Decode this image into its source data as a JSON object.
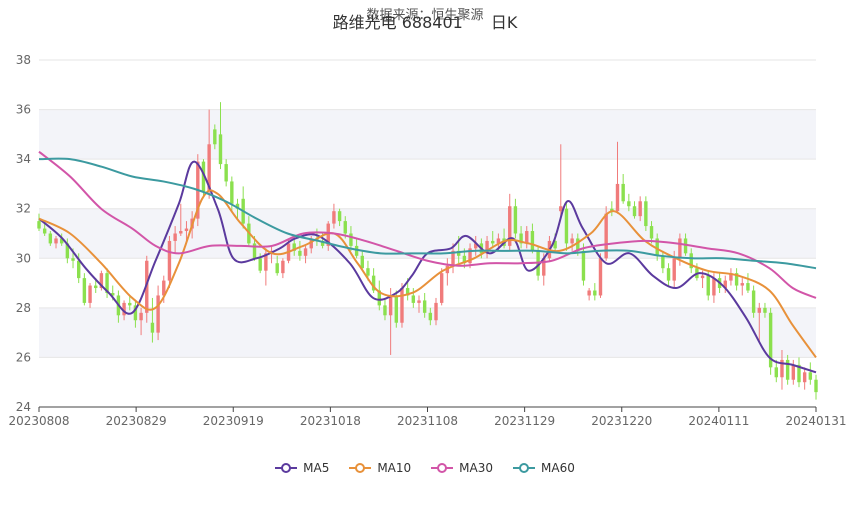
{
  "header": {
    "source": "数据来源：恒生聚源",
    "title": "路维光电 688401",
    "period": "日K"
  },
  "legend": [
    {
      "name": "MA5",
      "color": "#5b3a9e"
    },
    {
      "name": "MA10",
      "color": "#e8913a"
    },
    {
      "name": "MA30",
      "color": "#d255a8"
    },
    {
      "name": "MA60",
      "color": "#3c9aa0"
    }
  ],
  "colors": {
    "up": "#f07b7b",
    "down": "#8be04e",
    "grid": "#e6e6e6",
    "band": "#f3f4f9"
  },
  "chart_data": {
    "type": "candlestick",
    "title": "路维光电 688401 日K",
    "ylim": [
      24,
      38
    ],
    "y_ticks": [
      "24",
      "26",
      "28",
      "30",
      "32",
      "34",
      "36",
      "38"
    ],
    "x_ticks": [
      "20230808",
      "20230829",
      "20230919",
      "20231018",
      "20231108",
      "20231129",
      "20231220",
      "20240111",
      "20240131"
    ],
    "grid": true,
    "legend_position": "bottom",
    "candles": [
      {
        "o": 31.5,
        "h": 31.8,
        "l": 31.1,
        "c": 31.2
      },
      {
        "o": 31.2,
        "h": 31.4,
        "l": 30.9,
        "c": 31.0
      },
      {
        "o": 31.0,
        "h": 31.1,
        "l": 30.5,
        "c": 30.6
      },
      {
        "o": 30.6,
        "h": 30.9,
        "l": 30.4,
        "c": 30.8
      },
      {
        "o": 30.8,
        "h": 31.0,
        "l": 30.5,
        "c": 30.6
      },
      {
        "o": 30.6,
        "h": 30.8,
        "l": 29.8,
        "c": 30.0
      },
      {
        "o": 30.0,
        "h": 30.4,
        "l": 29.6,
        "c": 29.9
      },
      {
        "o": 29.9,
        "h": 30.2,
        "l": 29.0,
        "c": 29.2
      },
      {
        "o": 29.2,
        "h": 29.4,
        "l": 28.1,
        "c": 28.2
      },
      {
        "o": 28.2,
        "h": 29.0,
        "l": 28.0,
        "c": 28.9
      },
      {
        "o": 28.9,
        "h": 29.2,
        "l": 28.6,
        "c": 28.8
      },
      {
        "o": 28.8,
        "h": 29.5,
        "l": 28.7,
        "c": 29.4
      },
      {
        "o": 29.4,
        "h": 29.6,
        "l": 28.4,
        "c": 28.6
      },
      {
        "o": 28.6,
        "h": 28.9,
        "l": 28.3,
        "c": 28.5
      },
      {
        "o": 28.5,
        "h": 28.7,
        "l": 27.4,
        "c": 27.7
      },
      {
        "o": 27.7,
        "h": 28.3,
        "l": 27.5,
        "c": 28.2
      },
      {
        "o": 28.2,
        "h": 28.5,
        "l": 27.9,
        "c": 28.1
      },
      {
        "o": 28.1,
        "h": 28.3,
        "l": 27.2,
        "c": 27.5
      },
      {
        "o": 27.5,
        "h": 28.0,
        "l": 26.9,
        "c": 27.8
      },
      {
        "o": 27.8,
        "h": 30.1,
        "l": 27.4,
        "c": 29.9
      },
      {
        "o": 27.4,
        "h": 28.4,
        "l": 26.6,
        "c": 27.0
      },
      {
        "o": 27.0,
        "h": 28.9,
        "l": 26.7,
        "c": 28.5
      },
      {
        "o": 28.5,
        "h": 29.3,
        "l": 28.2,
        "c": 29.1
      },
      {
        "o": 29.1,
        "h": 30.9,
        "l": 28.8,
        "c": 30.7
      },
      {
        "o": 30.7,
        "h": 31.3,
        "l": 30.2,
        "c": 31.0
      },
      {
        "o": 31.0,
        "h": 32.2,
        "l": 30.9,
        "c": 31.1
      },
      {
        "o": 31.1,
        "h": 31.5,
        "l": 30.6,
        "c": 31.2
      },
      {
        "o": 31.2,
        "h": 31.9,
        "l": 30.8,
        "c": 31.6
      },
      {
        "o": 31.6,
        "h": 34.2,
        "l": 31.3,
        "c": 33.9
      },
      {
        "o": 33.9,
        "h": 34.0,
        "l": 32.5,
        "c": 32.7
      },
      {
        "o": 32.7,
        "h": 36.0,
        "l": 32.4,
        "c": 34.6
      },
      {
        "o": 35.2,
        "h": 35.4,
        "l": 34.4,
        "c": 34.6
      },
      {
        "o": 35.0,
        "h": 36.3,
        "l": 33.6,
        "c": 33.8
      },
      {
        "o": 33.8,
        "h": 34.0,
        "l": 32.9,
        "c": 33.1
      },
      {
        "o": 33.1,
        "h": 33.3,
        "l": 31.9,
        "c": 32.2
      },
      {
        "o": 32.2,
        "h": 32.4,
        "l": 31.6,
        "c": 32.0
      },
      {
        "o": 32.4,
        "h": 32.9,
        "l": 31.2,
        "c": 31.4
      },
      {
        "o": 31.4,
        "h": 31.7,
        "l": 30.5,
        "c": 30.6
      },
      {
        "o": 30.6,
        "h": 30.9,
        "l": 29.9,
        "c": 30.0
      },
      {
        "o": 30.0,
        "h": 30.2,
        "l": 29.4,
        "c": 29.5
      },
      {
        "o": 29.5,
        "h": 30.4,
        "l": 28.9,
        "c": 30.2
      },
      {
        "o": 30.2,
        "h": 30.5,
        "l": 29.8,
        "c": 30.3
      },
      {
        "o": 29.8,
        "h": 30.1,
        "l": 29.3,
        "c": 29.4
      },
      {
        "o": 29.4,
        "h": 30.0,
        "l": 29.2,
        "c": 29.9
      },
      {
        "o": 29.9,
        "h": 30.8,
        "l": 29.8,
        "c": 30.6
      },
      {
        "o": 30.6,
        "h": 30.9,
        "l": 30.1,
        "c": 30.3
      },
      {
        "o": 30.3,
        "h": 30.7,
        "l": 29.9,
        "c": 30.1
      },
      {
        "o": 30.1,
        "h": 30.5,
        "l": 29.8,
        "c": 30.4
      },
      {
        "o": 30.4,
        "h": 30.9,
        "l": 30.2,
        "c": 30.8
      },
      {
        "o": 30.8,
        "h": 31.2,
        "l": 30.5,
        "c": 30.7
      },
      {
        "o": 30.7,
        "h": 31.0,
        "l": 30.4,
        "c": 30.5
      },
      {
        "o": 30.5,
        "h": 31.5,
        "l": 30.3,
        "c": 31.4
      },
      {
        "o": 31.4,
        "h": 32.2,
        "l": 31.2,
        "c": 31.9
      },
      {
        "o": 31.9,
        "h": 32.0,
        "l": 31.3,
        "c": 31.5
      },
      {
        "o": 31.5,
        "h": 31.7,
        "l": 30.8,
        "c": 31.0
      },
      {
        "o": 31.0,
        "h": 31.3,
        "l": 30.3,
        "c": 30.5
      },
      {
        "o": 30.5,
        "h": 30.8,
        "l": 30.0,
        "c": 30.1
      },
      {
        "o": 30.1,
        "h": 30.3,
        "l": 29.5,
        "c": 29.6
      },
      {
        "o": 29.6,
        "h": 29.9,
        "l": 29.1,
        "c": 29.3
      },
      {
        "o": 29.3,
        "h": 29.6,
        "l": 28.6,
        "c": 28.7
      },
      {
        "o": 28.7,
        "h": 29.1,
        "l": 27.9,
        "c": 28.1
      },
      {
        "o": 28.1,
        "h": 28.4,
        "l": 27.5,
        "c": 27.7
      },
      {
        "o": 27.7,
        "h": 28.8,
        "l": 26.1,
        "c": 28.5
      },
      {
        "o": 28.5,
        "h": 28.7,
        "l": 27.2,
        "c": 27.4
      },
      {
        "o": 27.4,
        "h": 29.0,
        "l": 27.2,
        "c": 28.8
      },
      {
        "o": 28.8,
        "h": 29.2,
        "l": 28.3,
        "c": 28.5
      },
      {
        "o": 28.5,
        "h": 28.8,
        "l": 28.0,
        "c": 28.2
      },
      {
        "o": 28.2,
        "h": 28.5,
        "l": 27.8,
        "c": 28.3
      },
      {
        "o": 28.3,
        "h": 28.6,
        "l": 27.6,
        "c": 27.8
      },
      {
        "o": 27.8,
        "h": 28.0,
        "l": 27.3,
        "c": 27.5
      },
      {
        "o": 27.5,
        "h": 28.4,
        "l": 27.3,
        "c": 28.2
      },
      {
        "o": 28.2,
        "h": 29.6,
        "l": 28.1,
        "c": 29.4
      },
      {
        "o": 29.4,
        "h": 30.0,
        "l": 28.9,
        "c": 29.7
      },
      {
        "o": 29.7,
        "h": 30.6,
        "l": 29.4,
        "c": 30.3
      },
      {
        "o": 30.3,
        "h": 30.9,
        "l": 29.8,
        "c": 30.1
      },
      {
        "o": 30.1,
        "h": 30.4,
        "l": 29.6,
        "c": 29.8
      },
      {
        "o": 29.8,
        "h": 30.6,
        "l": 29.6,
        "c": 30.4
      },
      {
        "o": 30.4,
        "h": 30.9,
        "l": 30.1,
        "c": 30.6
      },
      {
        "o": 30.6,
        "h": 30.8,
        "l": 30.0,
        "c": 30.2
      },
      {
        "o": 30.2,
        "h": 30.9,
        "l": 30.0,
        "c": 30.7
      },
      {
        "o": 30.7,
        "h": 31.1,
        "l": 30.4,
        "c": 30.6
      },
      {
        "o": 30.6,
        "h": 31.0,
        "l": 30.3,
        "c": 30.8
      },
      {
        "o": 30.8,
        "h": 31.2,
        "l": 30.4,
        "c": 30.5
      },
      {
        "o": 30.5,
        "h": 32.6,
        "l": 30.3,
        "c": 32.1
      },
      {
        "o": 32.1,
        "h": 32.4,
        "l": 30.8,
        "c": 31.0
      },
      {
        "o": 31.0,
        "h": 31.3,
        "l": 30.4,
        "c": 30.6
      },
      {
        "o": 30.6,
        "h": 31.3,
        "l": 30.4,
        "c": 31.1
      },
      {
        "o": 31.1,
        "h": 31.4,
        "l": 30.2,
        "c": 30.3
      },
      {
        "o": 30.3,
        "h": 30.5,
        "l": 29.1,
        "c": 29.3
      },
      {
        "o": 29.3,
        "h": 30.2,
        "l": 28.9,
        "c": 30.0
      },
      {
        "o": 30.0,
        "h": 30.9,
        "l": 29.9,
        "c": 30.7
      },
      {
        "o": 30.7,
        "h": 31.0,
        "l": 30.2,
        "c": 30.4
      },
      {
        "o": 31.9,
        "h": 34.6,
        "l": 31.7,
        "c": 32.1
      },
      {
        "o": 32.0,
        "h": 32.3,
        "l": 30.3,
        "c": 30.6
      },
      {
        "o": 30.6,
        "h": 31.0,
        "l": 30.3,
        "c": 30.8
      },
      {
        "o": 30.8,
        "h": 31.0,
        "l": 30.1,
        "c": 30.3
      },
      {
        "o": 30.3,
        "h": 30.6,
        "l": 28.9,
        "c": 29.1
      },
      {
        "o": 28.5,
        "h": 28.8,
        "l": 28.3,
        "c": 28.7
      },
      {
        "o": 28.7,
        "h": 29.0,
        "l": 28.3,
        "c": 28.5
      },
      {
        "o": 28.5,
        "h": 30.2,
        "l": 28.4,
        "c": 30.0
      },
      {
        "o": 30.0,
        "h": 32.1,
        "l": 29.9,
        "c": 31.8
      },
      {
        "o": 32.0,
        "h": 32.3,
        "l": 31.7,
        "c": 31.9
      },
      {
        "o": 31.9,
        "h": 34.7,
        "l": 31.8,
        "c": 33.0
      },
      {
        "o": 33.0,
        "h": 33.4,
        "l": 32.2,
        "c": 32.3
      },
      {
        "o": 32.3,
        "h": 32.6,
        "l": 31.9,
        "c": 32.1
      },
      {
        "o": 32.1,
        "h": 32.3,
        "l": 31.6,
        "c": 31.7
      },
      {
        "o": 31.7,
        "h": 32.5,
        "l": 31.5,
        "c": 32.3
      },
      {
        "o": 32.3,
        "h": 32.5,
        "l": 31.1,
        "c": 31.3
      },
      {
        "o": 31.3,
        "h": 31.5,
        "l": 30.6,
        "c": 30.8
      },
      {
        "o": 30.8,
        "h": 31.0,
        "l": 29.9,
        "c": 30.1
      },
      {
        "o": 30.1,
        "h": 30.3,
        "l": 29.4,
        "c": 29.6
      },
      {
        "o": 29.6,
        "h": 29.8,
        "l": 28.9,
        "c": 29.1
      },
      {
        "o": 29.1,
        "h": 30.3,
        "l": 28.8,
        "c": 30.0
      },
      {
        "o": 30.0,
        "h": 31.0,
        "l": 29.7,
        "c": 30.8
      },
      {
        "o": 30.8,
        "h": 31.0,
        "l": 30.1,
        "c": 30.2
      },
      {
        "o": 30.2,
        "h": 30.4,
        "l": 29.4,
        "c": 29.6
      },
      {
        "o": 29.6,
        "h": 29.8,
        "l": 29.1,
        "c": 29.2
      },
      {
        "o": 29.2,
        "h": 29.5,
        "l": 28.8,
        "c": 29.3
      },
      {
        "o": 29.3,
        "h": 29.5,
        "l": 28.3,
        "c": 28.5
      },
      {
        "o": 28.5,
        "h": 29.4,
        "l": 28.2,
        "c": 29.2
      },
      {
        "o": 29.2,
        "h": 29.4,
        "l": 28.6,
        "c": 28.8
      },
      {
        "o": 28.8,
        "h": 29.3,
        "l": 28.6,
        "c": 29.1
      },
      {
        "o": 29.1,
        "h": 29.6,
        "l": 28.9,
        "c": 29.4
      },
      {
        "o": 29.4,
        "h": 29.6,
        "l": 28.7,
        "c": 28.9
      },
      {
        "o": 28.9,
        "h": 29.2,
        "l": 28.5,
        "c": 29.0
      },
      {
        "o": 29.0,
        "h": 29.4,
        "l": 28.6,
        "c": 28.7
      },
      {
        "o": 28.7,
        "h": 28.9,
        "l": 27.6,
        "c": 27.8
      },
      {
        "o": 27.8,
        "h": 28.2,
        "l": 26.6,
        "c": 28.0
      },
      {
        "o": 28.0,
        "h": 28.2,
        "l": 27.6,
        "c": 27.8
      },
      {
        "o": 27.8,
        "h": 28.0,
        "l": 25.3,
        "c": 25.6
      },
      {
        "o": 25.6,
        "h": 25.9,
        "l": 25.0,
        "c": 25.2
      },
      {
        "o": 25.2,
        "h": 26.3,
        "l": 24.7,
        "c": 25.9
      },
      {
        "o": 25.9,
        "h": 26.1,
        "l": 24.9,
        "c": 25.1
      },
      {
        "o": 25.1,
        "h": 25.9,
        "l": 24.9,
        "c": 25.7
      },
      {
        "o": 25.7,
        "h": 26.0,
        "l": 24.8,
        "c": 25.0
      },
      {
        "o": 25.0,
        "h": 25.6,
        "l": 24.7,
        "c": 25.4
      },
      {
        "o": 25.4,
        "h": 25.8,
        "l": 24.9,
        "c": 25.1
      },
      {
        "o": 25.1,
        "h": 25.3,
        "l": 24.3,
        "c": 24.6
      }
    ],
    "series": [
      {
        "name": "MA5",
        "color": "#5b3a9e",
        "x": [
          0,
          0.03,
          0.06,
          0.09,
          0.12,
          0.15,
          0.18,
          0.2,
          0.23,
          0.25,
          0.28,
          0.31,
          0.33,
          0.36,
          0.4,
          0.43,
          0.46,
          0.48,
          0.5,
          0.53,
          0.55,
          0.58,
          0.61,
          0.63,
          0.66,
          0.68,
          0.7,
          0.73,
          0.76,
          0.79,
          0.82,
          0.85,
          0.88,
          0.91,
          0.94,
          0.97,
          1.0
        ],
        "values": [
          31.6,
          30.8,
          29.6,
          28.6,
          27.8,
          29.9,
          32.2,
          33.9,
          32.0,
          30.0,
          30.0,
          30.4,
          30.8,
          30.9,
          29.8,
          28.4,
          28.6,
          29.3,
          30.2,
          30.4,
          30.9,
          30.2,
          30.8,
          29.5,
          30.5,
          32.3,
          31.2,
          29.8,
          30.2,
          29.3,
          28.8,
          29.4,
          28.9,
          27.6,
          26.0,
          25.7,
          25.4
        ]
      },
      {
        "name": "MA10",
        "color": "#e8913a",
        "x": [
          0,
          0.04,
          0.08,
          0.12,
          0.15,
          0.18,
          0.21,
          0.23,
          0.26,
          0.3,
          0.34,
          0.38,
          0.41,
          0.44,
          0.48,
          0.52,
          0.56,
          0.6,
          0.63,
          0.67,
          0.71,
          0.74,
          0.78,
          0.82,
          0.86,
          0.9,
          0.94,
          0.97,
          1.0
        ],
        "values": [
          31.6,
          31.0,
          29.8,
          28.4,
          28.0,
          29.8,
          32.4,
          32.6,
          31.4,
          30.2,
          30.5,
          31.0,
          29.8,
          28.6,
          28.6,
          29.5,
          30.0,
          30.7,
          30.6,
          30.3,
          31.0,
          31.9,
          30.7,
          30.0,
          29.5,
          29.3,
          28.7,
          27.3,
          26.0
        ]
      },
      {
        "name": "MA30",
        "color": "#d255a8",
        "x": [
          0,
          0.04,
          0.08,
          0.12,
          0.15,
          0.18,
          0.22,
          0.26,
          0.3,
          0.34,
          0.38,
          0.42,
          0.46,
          0.5,
          0.54,
          0.58,
          0.62,
          0.66,
          0.7,
          0.74,
          0.78,
          0.82,
          0.86,
          0.9,
          0.94,
          0.97,
          1.0
        ],
        "values": [
          34.3,
          33.3,
          32.0,
          31.2,
          30.5,
          30.2,
          30.5,
          30.5,
          30.5,
          31.0,
          31.0,
          30.7,
          30.3,
          29.9,
          29.7,
          29.8,
          29.8,
          29.9,
          30.4,
          30.6,
          30.7,
          30.6,
          30.4,
          30.2,
          29.6,
          28.8,
          28.4
        ]
      },
      {
        "name": "MA60",
        "color": "#3c9aa0",
        "x": [
          0,
          0.04,
          0.08,
          0.12,
          0.16,
          0.2,
          0.24,
          0.28,
          0.32,
          0.36,
          0.4,
          0.44,
          0.48,
          0.52,
          0.56,
          0.6,
          0.64,
          0.68,
          0.72,
          0.76,
          0.8,
          0.84,
          0.88,
          0.92,
          0.96,
          1.0
        ],
        "values": [
          34.0,
          34.0,
          33.7,
          33.3,
          33.1,
          32.8,
          32.3,
          31.6,
          31.0,
          30.7,
          30.4,
          30.2,
          30.2,
          30.2,
          30.3,
          30.3,
          30.3,
          30.2,
          30.3,
          30.3,
          30.1,
          30.0,
          30.0,
          29.9,
          29.8,
          29.6
        ]
      }
    ]
  }
}
